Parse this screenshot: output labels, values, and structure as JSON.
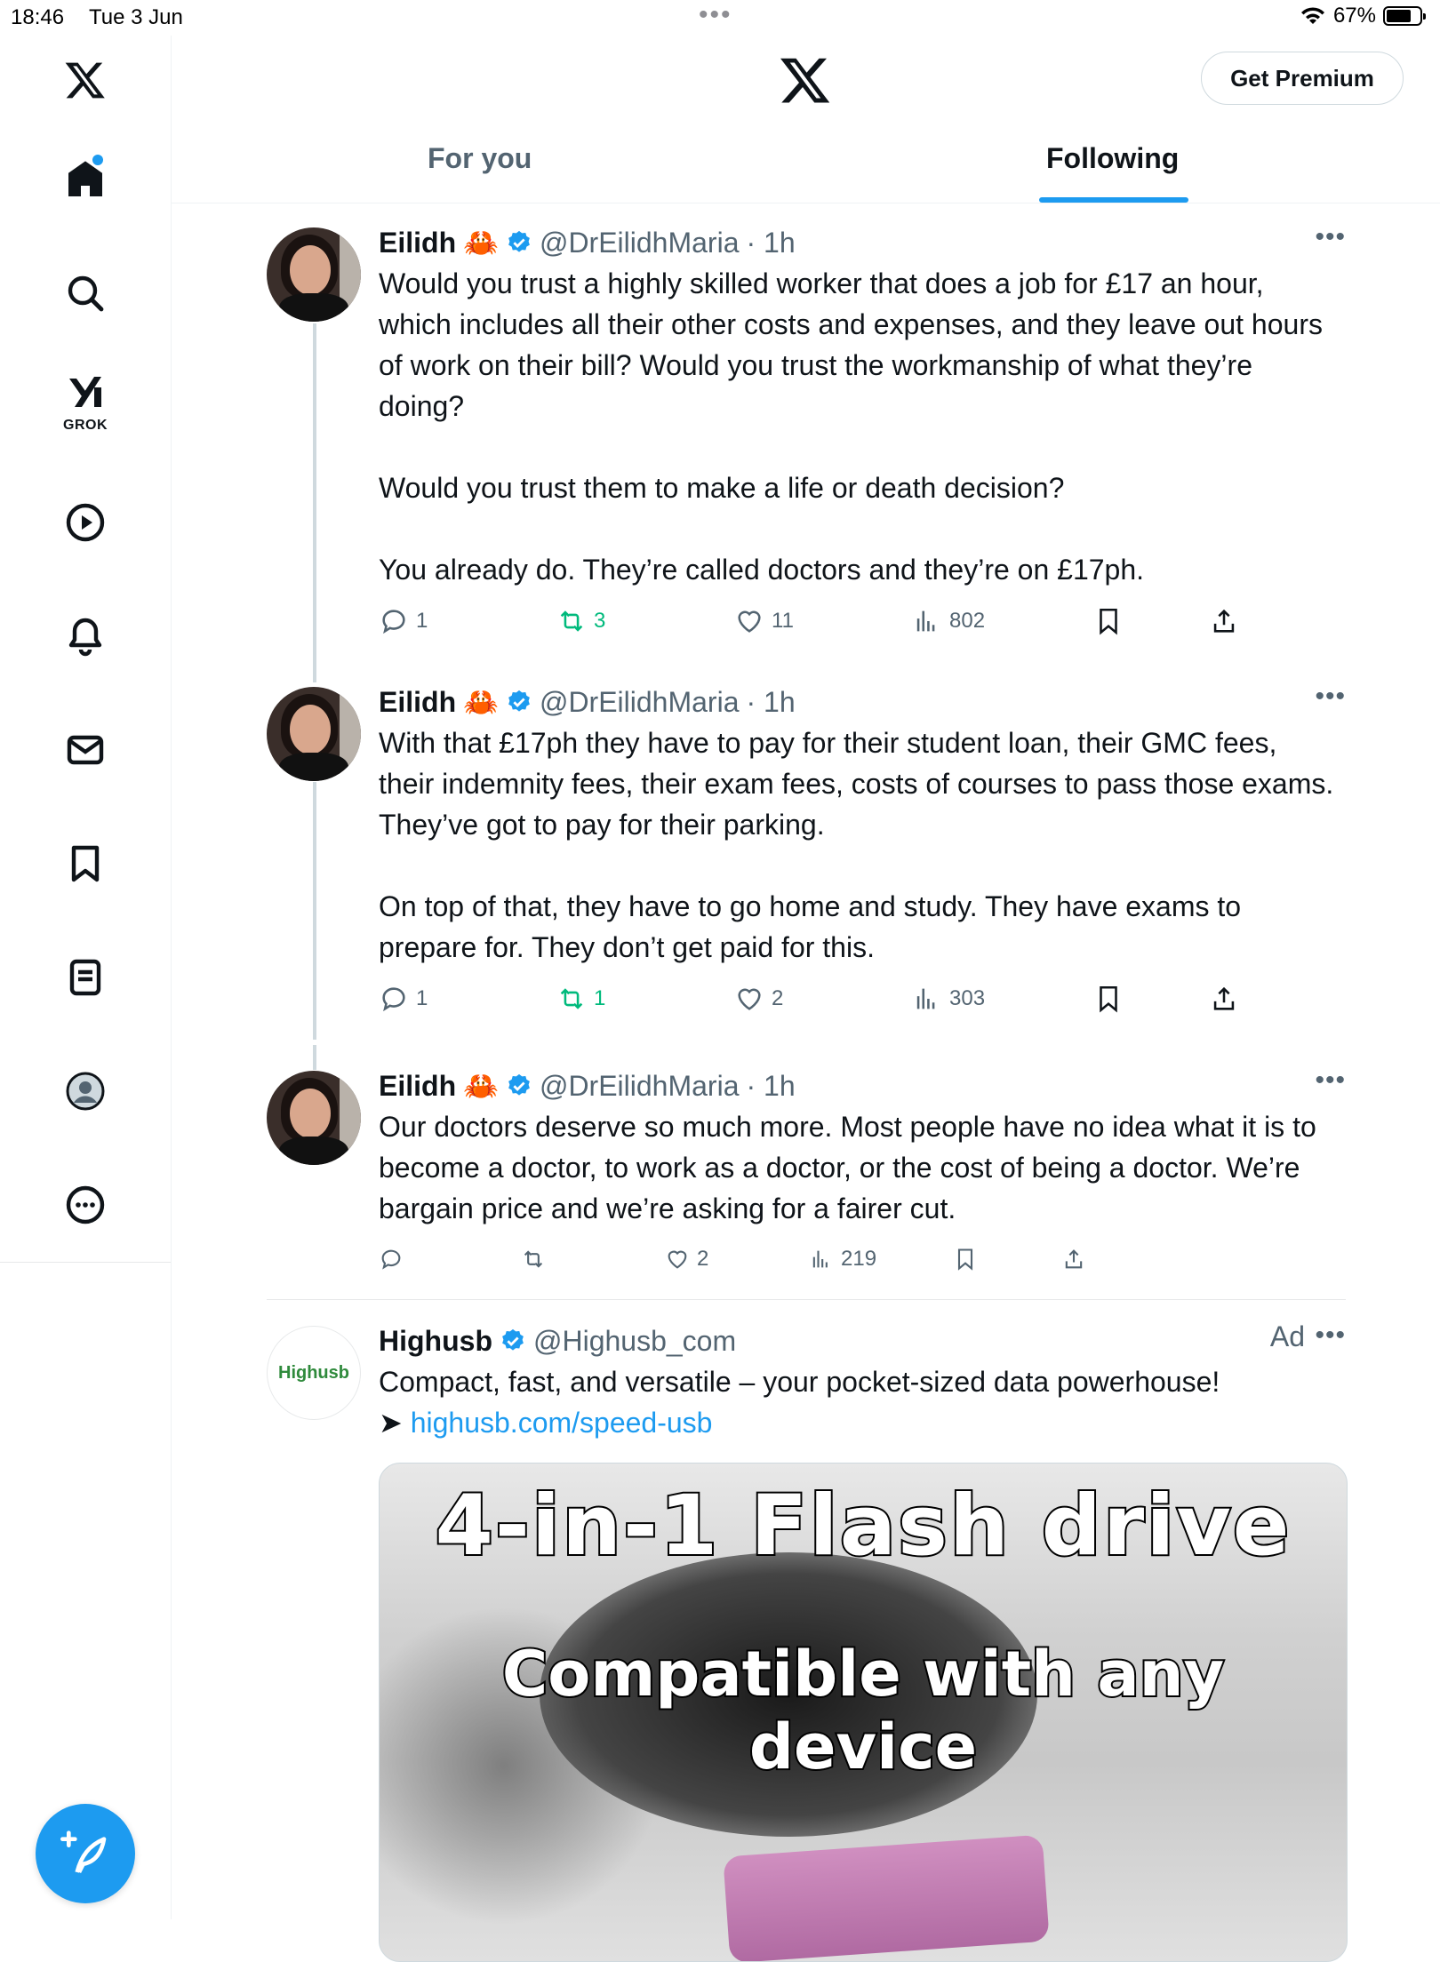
{
  "status_bar": {
    "time": "18:46",
    "date": "Tue 3 Jun",
    "battery": "67%"
  },
  "sidebar": {
    "items": [
      {
        "name": "home",
        "icon": "home-icon"
      },
      {
        "name": "explore",
        "icon": "search-icon"
      },
      {
        "name": "grok",
        "icon": "grok-icon",
        "label": "GROK"
      },
      {
        "name": "video",
        "icon": "play-icon"
      },
      {
        "name": "notifications",
        "icon": "bell-icon"
      },
      {
        "name": "messages",
        "icon": "envelope-icon"
      },
      {
        "name": "bookmarks",
        "icon": "bookmark-icon"
      },
      {
        "name": "lists",
        "icon": "list-icon"
      },
      {
        "name": "profile",
        "icon": "avatar-icon"
      },
      {
        "name": "more",
        "icon": "more-icon"
      }
    ],
    "compose_icon": "feather-plus-icon"
  },
  "header": {
    "premium_label": "Get Premium",
    "tabs": [
      {
        "label": "For you",
        "active": false
      },
      {
        "label": "Following",
        "active": true
      }
    ]
  },
  "tweets": [
    {
      "name": "Eilidh",
      "emoji": "🦀",
      "handle": "@DrEilidhMaria",
      "time": "· 1h",
      "text": "Would you trust a highly skilled worker that does a job for £17 an hour, which includes all their other costs and expenses, and they leave out hours of work on their bill? Would you trust the workmanship of what they’re doing?\n\nWould you trust them to make a life or death decision?\n\nYou already do. They’re called doctors and they’re on £17ph.",
      "replies": "1",
      "reposts": "3",
      "likes": "11",
      "views": "802"
    },
    {
      "name": "Eilidh",
      "emoji": "🦀",
      "handle": "@DrEilidhMaria",
      "time": "· 1h",
      "text": "With that £17ph they have to pay for their student loan, their GMC fees, their indemnity fees, their exam fees, costs of courses to pass those exams. They’ve got to pay for their parking.\n\nOn top of that, they have to go home and study. They have exams to prepare for. They don’t get paid for this.",
      "replies": "1",
      "reposts": "1",
      "likes": "2",
      "views": "303"
    },
    {
      "name": "Eilidh",
      "emoji": "🦀",
      "handle": "@DrEilidhMaria",
      "time": "· 1h",
      "text": "Our doctors deserve so much more. Most people have no idea what it is to become a doctor, to work as a doctor, or the cost of being a doctor. We’re bargain price and we’re asking for a fairer cut.",
      "replies": "",
      "reposts": "",
      "likes": "2",
      "views": "219"
    }
  ],
  "ad": {
    "avatar_text": "Highusb",
    "name": "Highusb",
    "handle": "@Highusb_com",
    "ad_label": "Ad",
    "text": "Compact, fast, and versatile – your pocket-sized data powerhouse!",
    "arrow": "➤ ",
    "link": "highusb.com/speed-usb",
    "media_caption_1": "4-in-1 Flash drive",
    "media_caption_2": "Compatible with any device"
  },
  "colors": {
    "accent": "#1d9bf0",
    "repost": "#00ba7c",
    "muted": "#536471"
  }
}
